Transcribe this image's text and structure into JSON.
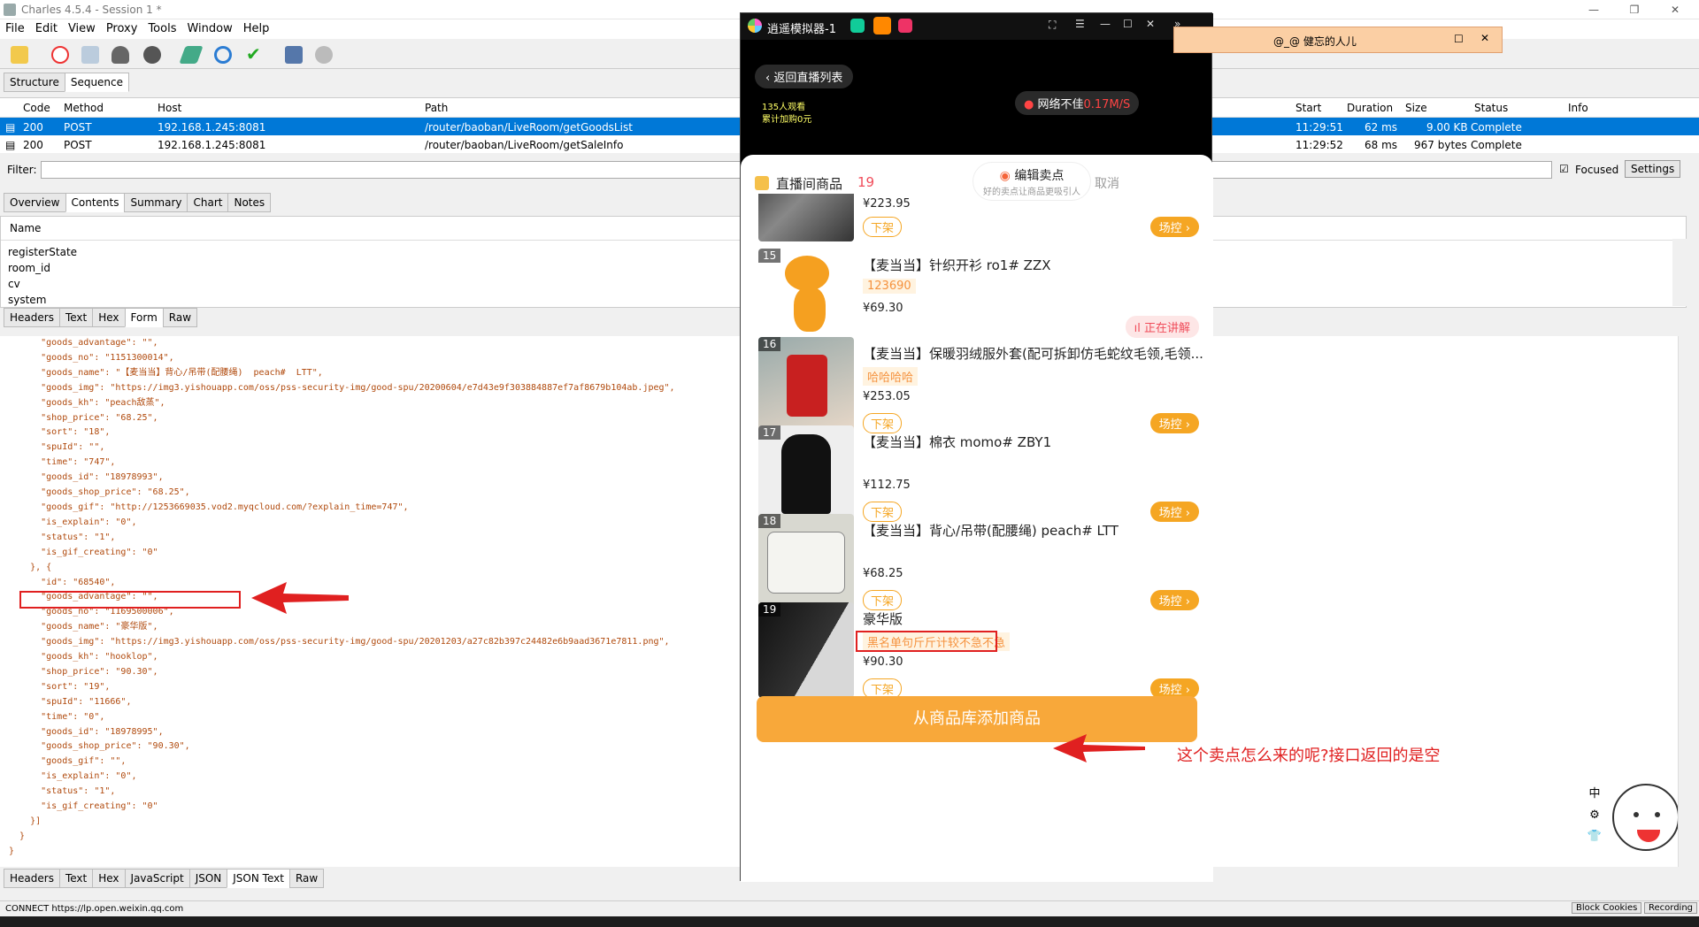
{
  "window": {
    "title": "Charles 4.5.4 - Session 1 *"
  },
  "menu": [
    "File",
    "Edit",
    "View",
    "Proxy",
    "Tools",
    "Window",
    "Help"
  ],
  "view_tabs": [
    "Structure",
    "Sequence"
  ],
  "table": {
    "headers": [
      "Code",
      "Method",
      "Host",
      "Path",
      "Start",
      "Duration",
      "Size",
      "Status",
      "Info"
    ],
    "rows": [
      {
        "code": "200",
        "method": "POST",
        "host": "192.168.1.245:8081",
        "path": "/router/baoban/LiveRoom/getGoodsList",
        "start": "11:29:51",
        "duration": "62 ms",
        "size": "9.00 KB",
        "status": "Complete"
      },
      {
        "code": "200",
        "method": "POST",
        "host": "192.168.1.245:8081",
        "path": "/router/baoban/LiveRoom/getSaleInfo",
        "start": "11:29:52",
        "duration": "68 ms",
        "size": "967 bytes",
        "status": "Complete"
      }
    ]
  },
  "filter": {
    "label": "Filter:",
    "focused_label": "Focused",
    "settings_label": "Settings"
  },
  "detail_tabs": [
    "Overview",
    "Contents",
    "Summary",
    "Chart",
    "Notes"
  ],
  "request": {
    "name_header": "Name",
    "params": [
      "registerState",
      "room_id",
      "cv",
      "system"
    ],
    "tabs": [
      "Headers",
      "Text",
      "Hex",
      "Form",
      "Raw"
    ]
  },
  "response_tabs": [
    "Headers",
    "Text",
    "Hex",
    "JavaScript",
    "JSON",
    "JSON Text",
    "Raw"
  ],
  "code_lines": [
    "      \"goods_advantage\": \"\",",
    "      \"goods_no\": \"1151300014\",",
    "      \"goods_name\": \"【麦当当】背心/吊带(配腰绳)  peach#  LTT\",",
    "      \"goods_img\": \"https://img3.yishouapp.com/oss/pss-security-img/good-spu/20200604/e7d43e9f303884887ef7af8679b104ab.jpeg\",",
    "      \"goods_kh\": \"peach敌蒸\",",
    "      \"shop_price\": \"68.25\",",
    "      \"sort\": \"18\",",
    "      \"spuId\": \"\",",
    "      \"time\": \"747\",",
    "      \"goods_id\": \"18978993\",",
    "      \"goods_shop_price\": \"68.25\",",
    "      \"goods_gif\": \"http://1253669035.vod2.myqcloud.com/?explain_time=747\",",
    "      \"is_explain\": \"0\",",
    "      \"status\": \"1\",",
    "      \"is_gif_creating\": \"0\"",
    "    }, {",
    "      \"id\": \"68540\",",
    "      \"goods_advantage\": \"\",",
    "      \"goods_no\": \"1169500006\",",
    "      \"goods_name\": \"豪华版\",",
    "      \"goods_img\": \"https://img3.yishouapp.com/oss/pss-security-img/good-spu/20201203/a27c82b397c24482e6b9aad3671e7811.png\",",
    "      \"goods_kh\": \"hooklop\",",
    "      \"shop_price\": \"90.30\",",
    "      \"sort\": \"19\",",
    "      \"spuId\": \"11666\",",
    "      \"time\": \"0\",",
    "      \"goods_id\": \"18978995\",",
    "      \"goods_shop_price\": \"90.30\",",
    "      \"goods_gif\": \"\",",
    "      \"is_explain\": \"0\",",
    "      \"status\": \"1\",",
    "      \"is_gif_creating\": \"0\"",
    "    }]",
    "  }",
    "}"
  ],
  "statusbar": {
    "text": "CONNECT https://lp.open.weixin.qq.com",
    "block_cookies": "Block Cookies",
    "recording": "Recording"
  },
  "emulator": {
    "title": "逍遥模拟器-1",
    "back_label": "返回直播列表",
    "viewers": "135人观看",
    "added": "累计加购0元",
    "network": "网络不佳",
    "speed": "0.17M/S",
    "sheet_title": "直播间商品",
    "count": "19",
    "edit_label": "编辑卖点",
    "edit_sub": "好的卖点让商品更吸引人",
    "cancel": "取消",
    "add_button": "从商品库添加商品",
    "off_label": "下架",
    "scene_label": "场控 ›",
    "live_label": "正在讲解",
    "items": [
      {
        "num": "",
        "name": "",
        "tag": "",
        "price": "¥223.95",
        "live": false
      },
      {
        "num": "15",
        "name": "【麦当当】针织开衫 ro1# ZZX",
        "tag": "123690",
        "price": "¥69.30",
        "live": true
      },
      {
        "num": "16",
        "name": "【麦当当】保暖羽绒服外套(配可拆卸仿毛蛇纹毛领,毛领...",
        "tag": "哈哈哈哈",
        "price": "¥253.05",
        "live": false
      },
      {
        "num": "17",
        "name": "【麦当当】棉衣 momo# ZBY1",
        "tag": "",
        "price": "¥112.75",
        "live": false
      },
      {
        "num": "18",
        "name": "【麦当当】背心/吊带(配腰绳) peach# LTT",
        "tag": "",
        "price": "¥68.25",
        "live": false
      },
      {
        "num": "19",
        "name": "豪华版",
        "tag": "黑名单句斤斤计较不急不急",
        "price": "¥90.30",
        "live": false
      }
    ]
  },
  "popup": {
    "title": "@_@  健忘的人儿"
  },
  "annotation": {
    "text": "这个卖点怎么来的呢?接口返回的是空"
  },
  "side_icons": [
    "中",
    "⚙",
    "👕"
  ],
  "colors": {
    "accent": "#f5a623",
    "selection": "#0078d7",
    "annotation_red": "#e02020",
    "json_text": "#b0490c"
  }
}
